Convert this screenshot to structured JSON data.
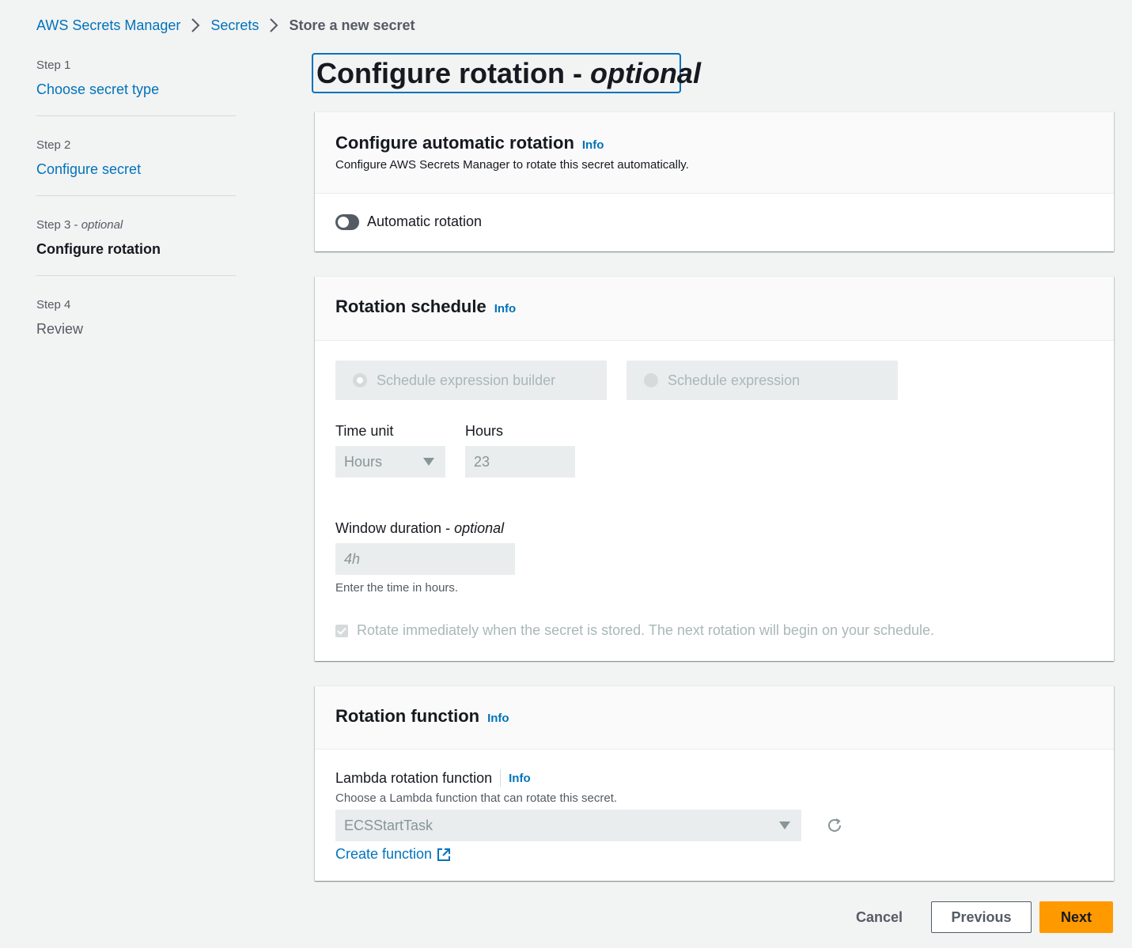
{
  "breadcrumb": {
    "items": [
      "AWS Secrets Manager",
      "Secrets"
    ],
    "current": "Store a new secret"
  },
  "sidebar": {
    "steps": [
      {
        "number": "Step 1",
        "label": "Choose secret type",
        "state": "link"
      },
      {
        "number": "Step 2",
        "label": "Configure secret",
        "state": "link"
      },
      {
        "number": "Step 3",
        "optional": "optional",
        "label": "Configure rotation",
        "state": "current"
      },
      {
        "number": "Step 4",
        "label": "Review",
        "state": "disabled"
      }
    ]
  },
  "page": {
    "title": "Configure rotation - ",
    "title_optional": "optional"
  },
  "auto_rotation": {
    "title": "Configure automatic rotation",
    "info": "Info",
    "description": "Configure AWS Secrets Manager to rotate this secret automatically.",
    "toggle_label": "Automatic rotation",
    "toggle_on": false
  },
  "schedule": {
    "title": "Rotation schedule",
    "info": "Info",
    "options": [
      "Schedule expression builder",
      "Schedule expression"
    ],
    "time_unit_label": "Time unit",
    "time_unit_value": "Hours",
    "hours_label": "Hours",
    "hours_value": "23",
    "window_label": "Window duration - ",
    "window_optional": "optional",
    "window_placeholder": "4h",
    "window_hint": "Enter the time in hours.",
    "rotate_immediately": "Rotate immediately when the secret is stored. The next rotation will begin on your schedule."
  },
  "function": {
    "title": "Rotation function",
    "info": "Info",
    "lambda_label": "Lambda rotation function",
    "lambda_info": "Info",
    "lambda_desc": "Choose a Lambda function that can rotate this secret.",
    "lambda_value": "ECSStartTask",
    "create_link": "Create function"
  },
  "footer": {
    "cancel": "Cancel",
    "previous": "Previous",
    "next": "Next"
  },
  "colors": {
    "link": "#0073bb",
    "primary_button": "#ff9900",
    "background": "#f2f3f3"
  }
}
